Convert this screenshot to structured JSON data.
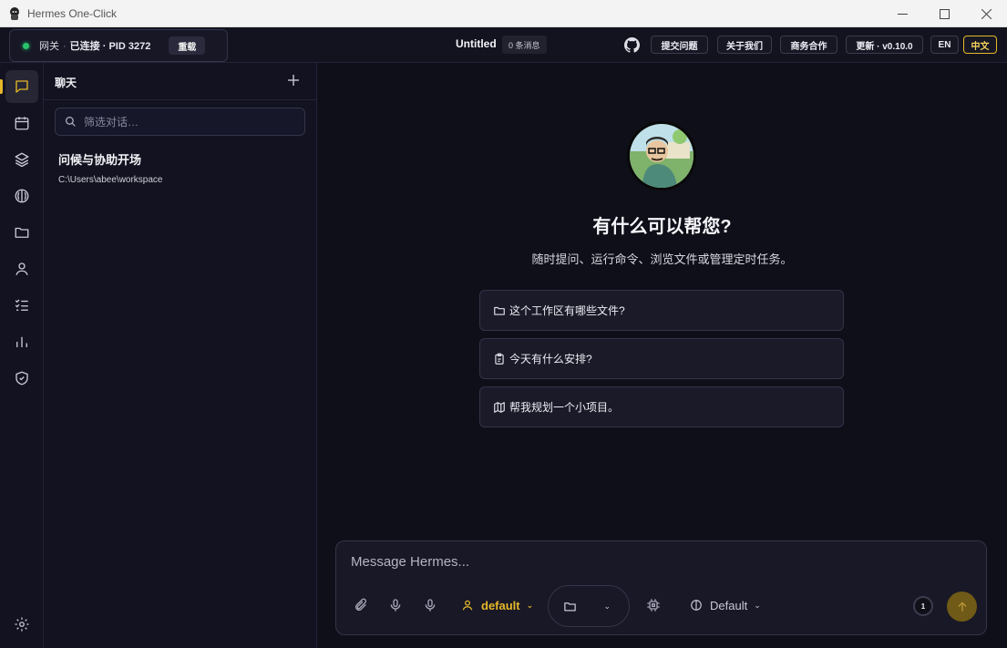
{
  "window": {
    "title": "Hermes One-Click"
  },
  "header": {
    "gateway_label": "网关",
    "gateway_status": "已连接 · PID 3272",
    "restart_label": "重载",
    "doc_title": "Untitled",
    "message_count": "0 条消息",
    "buttons": {
      "report_issue": "提交问题",
      "about": "关于我们",
      "business": "商务合作",
      "update": "更新 · v0.10.0",
      "lang_en": "EN",
      "lang_zh": "中文"
    }
  },
  "rail": {
    "items": [
      "chat-icon",
      "calendar-icon",
      "layers-icon",
      "brain-icon",
      "folder-icon",
      "user-icon",
      "checklist-icon",
      "bar-chart-icon",
      "shield-icon"
    ],
    "bottom": "gear-icon",
    "accent": "#e5b829"
  },
  "sidebar": {
    "title": "聊天",
    "search_placeholder": "筛选对话…",
    "conversations": [
      {
        "title": "问候与协助开场",
        "path": "C:\\Users\\abee\\workspace"
      }
    ]
  },
  "main": {
    "hero_title": "有什么可以帮您?",
    "hero_subtitle": "随时提问、运行命令、浏览文件或管理定时任务。",
    "suggestions": [
      {
        "icon": "folder-icon",
        "text": "这个工作区有哪些文件?"
      },
      {
        "icon": "clipboard-icon",
        "text": "今天有什么安排?"
      },
      {
        "icon": "map-icon",
        "text": "帮我规划一个小项目。"
      }
    ]
  },
  "composer": {
    "placeholder": "Message Hermes...",
    "profile": "default",
    "model": "Default",
    "counter": "1"
  }
}
